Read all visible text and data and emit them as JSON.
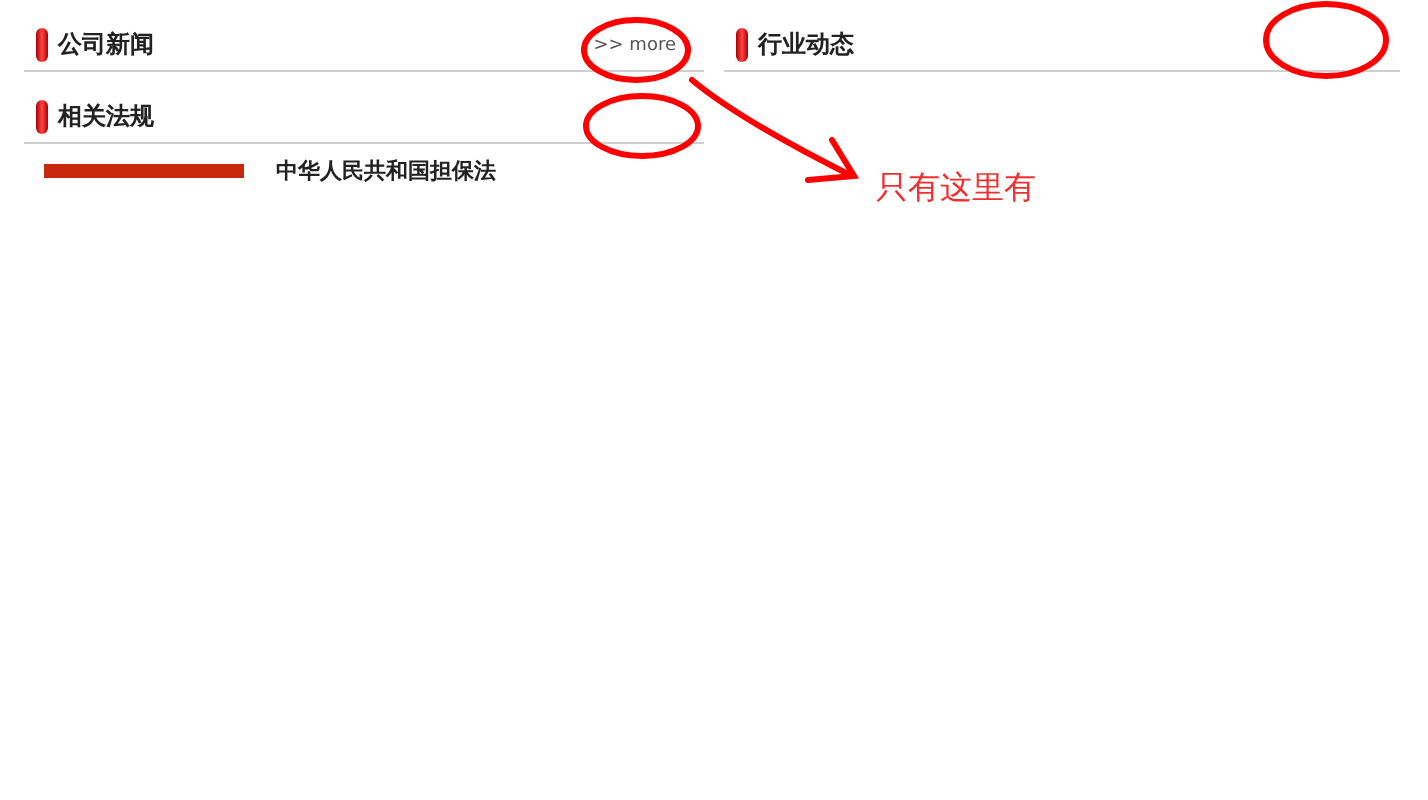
{
  "left_column": [
    {
      "title": "公司新闻",
      "more_link": ">> more"
    },
    {
      "title": "相关法规",
      "items": [
        {
          "title": "中华人民共和国担保法"
        }
      ]
    }
  ],
  "right_column": [
    {
      "title": "行业动态"
    }
  ],
  "annotation": {
    "note": "只有这里有"
  }
}
